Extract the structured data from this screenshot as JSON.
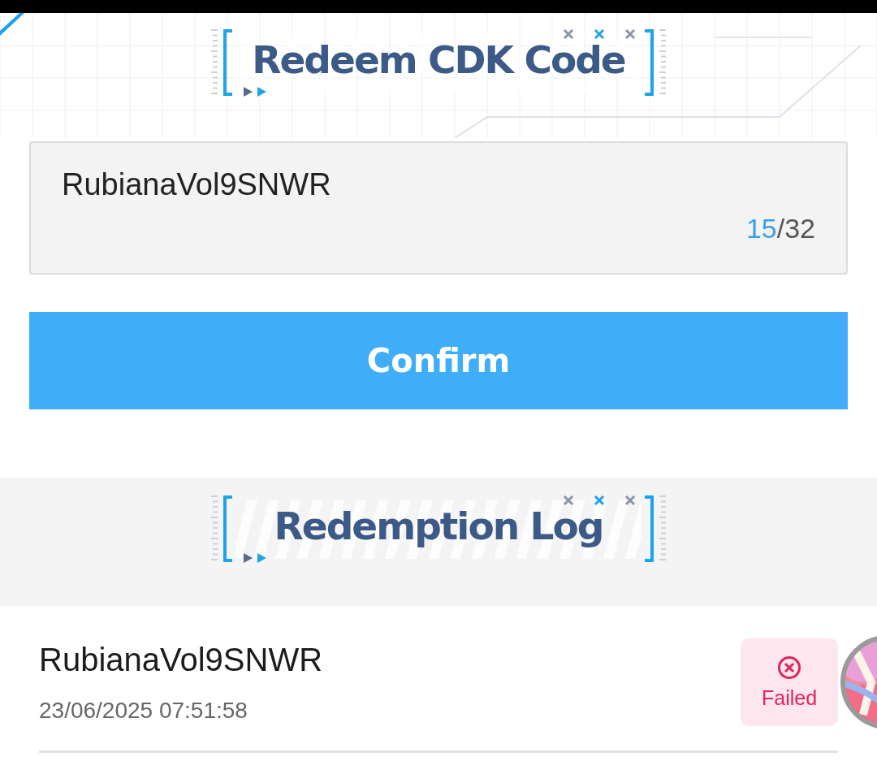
{
  "header": {
    "title": "Redeem CDK Code"
  },
  "code_field": {
    "value": "RubianaVol9SNWR",
    "count": "15",
    "limit": "/32"
  },
  "confirm_button": {
    "label": "Confirm"
  },
  "log": {
    "title": "Redemption Log",
    "entries": [
      {
        "code": "RubianaVol9SNWR",
        "time": "23/06/2025 07:51:58",
        "status": {
          "kind": "failed",
          "label": "Failed"
        }
      }
    ]
  }
}
